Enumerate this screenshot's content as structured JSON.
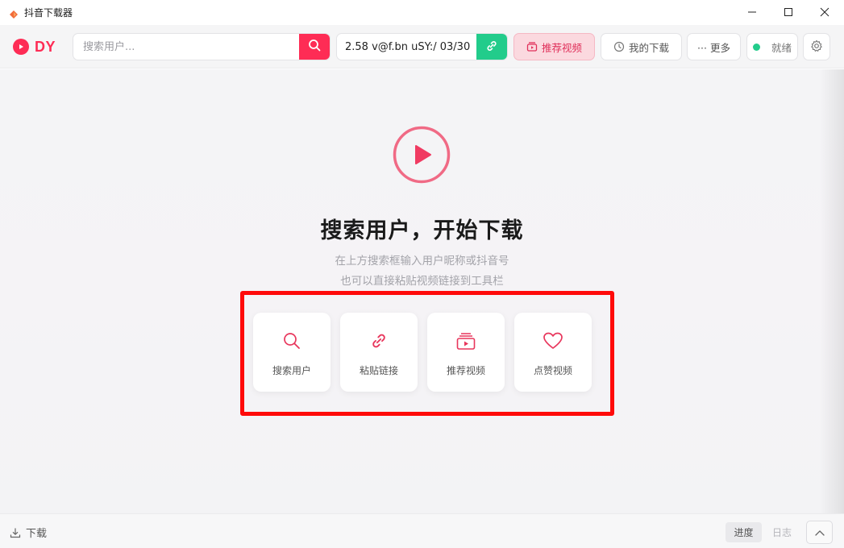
{
  "window": {
    "title": "抖音下载器",
    "icons": {
      "app": "app-logo-icon",
      "minimize": "minimize-icon",
      "maximize": "maximize-icon",
      "close": "close-icon"
    }
  },
  "toolbar": {
    "logo_text": "DY",
    "search": {
      "placeholder": "搜索用户...",
      "value": ""
    },
    "link": {
      "value": "2.58 v@f.bn uSY:/ 03/30"
    },
    "recommend_label": "推荐视频",
    "my_downloads_label": "我的下载",
    "more_label": "··· 更多",
    "status_label": "就绪",
    "colors": {
      "accent": "#fe2c55",
      "success": "#22cc8b",
      "recommend_bg": "#fbd9df"
    }
  },
  "hero": {
    "title": "搜索用户，开始下载",
    "subtitle_line1": "在上方搜索框输入用户昵称或抖音号",
    "subtitle_line2": "也可以直接粘贴视频链接到工具栏"
  },
  "quick_actions": [
    {
      "label": "搜索用户",
      "icon": "search-icon"
    },
    {
      "label": "粘贴链接",
      "icon": "link-icon"
    },
    {
      "label": "推荐视频",
      "icon": "video-stack-icon"
    },
    {
      "label": "点赞视频",
      "icon": "heart-icon"
    }
  ],
  "bottom_bar": {
    "download_label": "下载",
    "progress_tab": "进度",
    "log_tab": "日志"
  }
}
